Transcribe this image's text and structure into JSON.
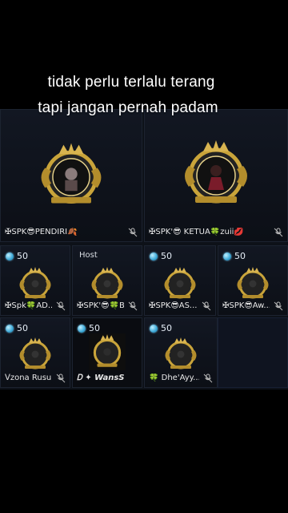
{
  "caption": {
    "line1": "tidak perlu terlalu terang",
    "line2": "tapi jangan pernah padam"
  },
  "seats_top": [
    {
      "name": "✠SPK😎PENDIRI🍂",
      "muted": true
    },
    {
      "name": "✠SPK'😎 KETUA🍀zuii💋",
      "muted": true
    }
  ],
  "seats_row2": [
    {
      "badge": "50",
      "name": "✠Spk🍀AD...",
      "muted": true
    },
    {
      "host": "Host",
      "name": "✠SPK'😎🍀BU...",
      "muted": true
    },
    {
      "badge": "50",
      "name": "✠SPK😎AS...",
      "muted": true
    },
    {
      "badge": "50",
      "name": "✠SPK😎Aw...",
      "muted": true
    }
  ],
  "seats_row3": [
    {
      "badge": "50",
      "name": "ᐯzona Rusuh ...",
      "muted": true
    },
    {
      "badge": "50",
      "name": "Ꭰ ✦ WansS...",
      "muted": false
    },
    {
      "badge": "50",
      "name": "🍀 Dhe'Ayy...",
      "muted": true
    }
  ],
  "icons": {
    "coin": "diamond-coin-icon",
    "mic": "mic-off-icon",
    "emblem": "crown-lion-crest-icon"
  },
  "colors": {
    "gold": "#c9a43a",
    "coin": "#3aa7d6",
    "background": "#000000"
  }
}
